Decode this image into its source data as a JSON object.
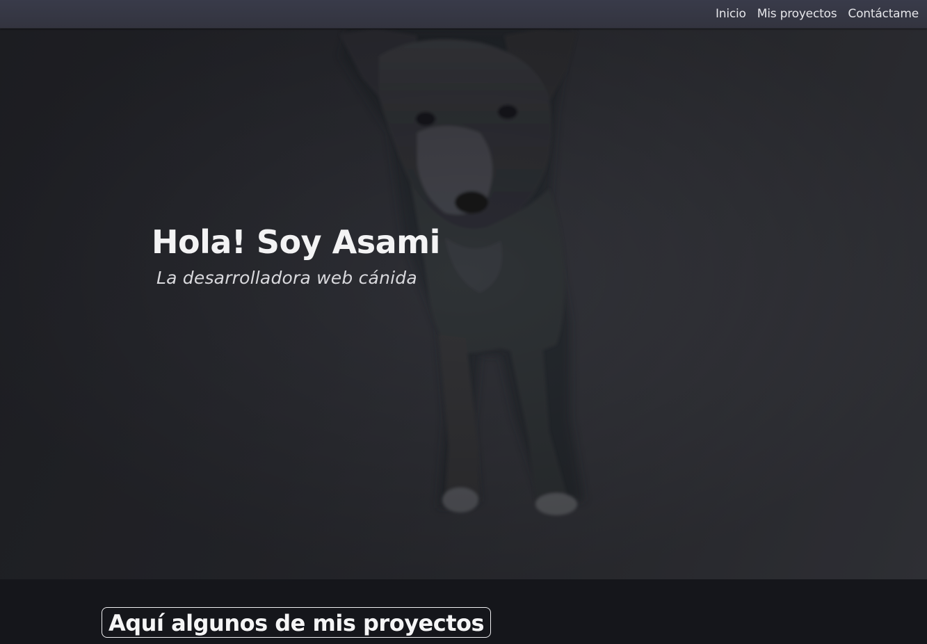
{
  "nav": {
    "links": [
      "Inicio",
      "Mis proyectos",
      "Contáctame"
    ]
  },
  "hero": {
    "title": "Hola! Soy Asami",
    "subtitle": "La desarrolladora web cánida"
  },
  "projects": {
    "heading": "Aquí algunos de mis proyectos"
  },
  "colors": {
    "navbar": "#363845",
    "hero_background": "#2c2d33",
    "section_background": "#15161b",
    "text": "#f3f3f4"
  }
}
